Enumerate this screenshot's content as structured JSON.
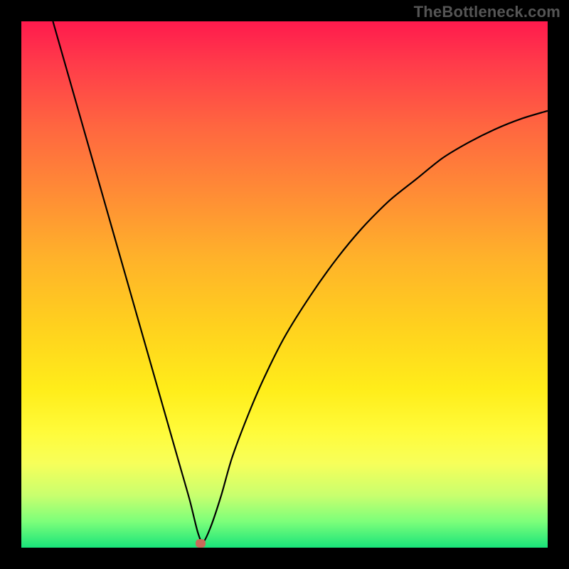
{
  "watermark": "TheBottleneck.com",
  "chart_data": {
    "type": "line",
    "title": "",
    "xlabel": "",
    "ylabel": "",
    "xlim": [
      0,
      100
    ],
    "ylim": [
      0,
      100
    ],
    "grid": false,
    "legend": false,
    "series": [
      {
        "name": "bottleneck-curve",
        "x": [
          6,
          8,
          10,
          12,
          14,
          16,
          18,
          20,
          22,
          24,
          26,
          28,
          30,
          32,
          33.5,
          34.5,
          36,
          38,
          40,
          43,
          46,
          50,
          55,
          60,
          65,
          70,
          75,
          80,
          85,
          90,
          95,
          100
        ],
        "values": [
          100,
          93,
          86,
          79,
          72,
          65,
          58,
          51,
          44,
          37,
          30,
          23,
          16,
          9,
          3,
          1,
          4,
          10,
          17,
          25,
          32,
          40,
          48,
          55,
          61,
          66,
          70,
          74,
          77,
          79.5,
          81.5,
          83
        ]
      }
    ],
    "marker": {
      "x": 34,
      "y": 0.8
    },
    "colors": {
      "curve": "#000000",
      "marker": "#c96a5a",
      "background_top": "#ff1a4d",
      "background_bottom": "#19e47a",
      "frame": "#000000",
      "watermark": "#555555"
    }
  }
}
